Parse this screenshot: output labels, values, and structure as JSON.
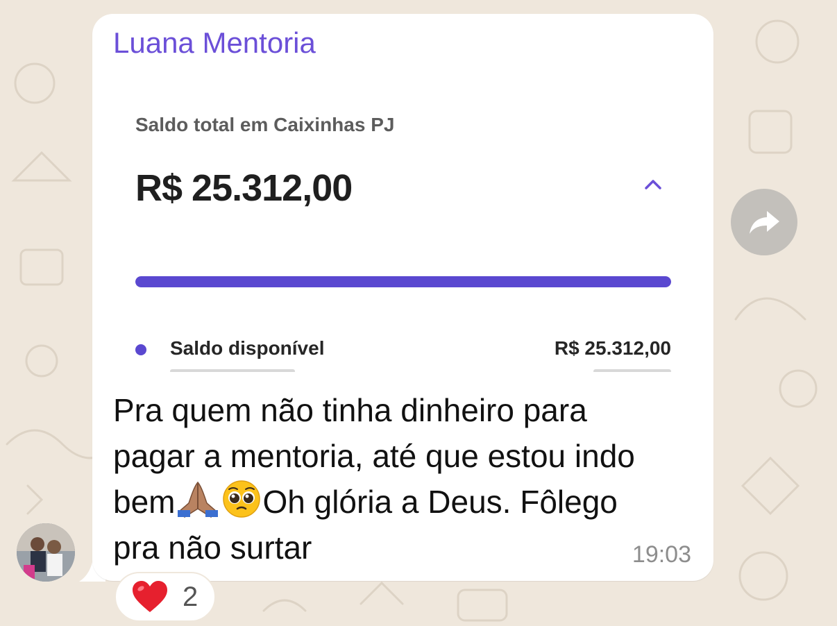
{
  "message": {
    "sender": "Luana Mentoria",
    "text_line1": "Pra quem não tinha dinheiro para",
    "text_line2": "pagar a mentoria, até que estou indo",
    "text_line3_a": "bem",
    "text_line3_b": "Oh glória a Deus. Fôlego",
    "text_line4": "pra não surtar",
    "time": "19:03"
  },
  "attached_screenshot": {
    "title": "Saldo total em Caixinhas PJ",
    "amount": "R$ 25.312,00",
    "progress_fraction": 1.0,
    "rows": [
      {
        "label": "Saldo disponível",
        "value": "R$ 25.312,00"
      }
    ]
  },
  "reaction": {
    "emoji": "❤️",
    "count": "2"
  },
  "icons": {
    "forward": "forward-icon",
    "chevron": "chevron-up-icon",
    "pray": "folded-hands-emoji",
    "pleading": "pleading-face-emoji",
    "heart": "red-heart-emoji"
  },
  "colors": {
    "sender": "#6b4fd8",
    "accent": "#5a48d0",
    "background": "#efe7dc",
    "bubble": "#ffffff"
  }
}
